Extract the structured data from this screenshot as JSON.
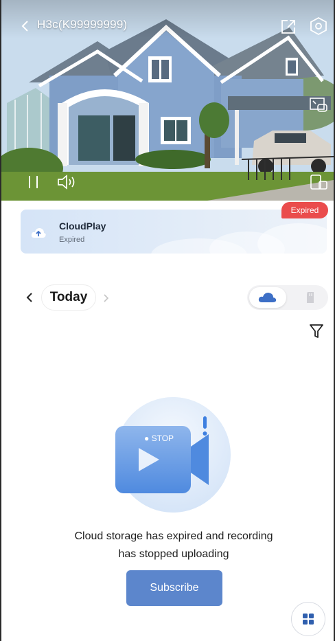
{
  "header": {
    "device_title": "H3c(K99999999)"
  },
  "icons": {
    "back": "chevron-left-icon",
    "share": "share-icon",
    "settings": "hexagon-settings-icon",
    "pip": "picture-in-picture-icon",
    "multiscreen": "multi-screen-icon",
    "pause": "pause-icon",
    "sound": "speaker-icon",
    "cloud_upload": "cloud-upload-icon",
    "cloud": "cloud-icon",
    "sd_card": "sd-card-icon",
    "filter": "filter-icon",
    "grid": "grid-menu-icon"
  },
  "cloud_play": {
    "title": "CloudPlay",
    "status": "Expired",
    "badge": "Expired"
  },
  "date_nav": {
    "label": "Today"
  },
  "empty_state": {
    "illustration_text": "● STOP",
    "line1": "Cloud storage has expired and recording",
    "line2": "has stopped uploading",
    "button": "Subscribe"
  },
  "colors": {
    "accent": "#5c86cc",
    "badge_red": "#ea4c4c",
    "banner_bg": "#d5e4f7"
  }
}
